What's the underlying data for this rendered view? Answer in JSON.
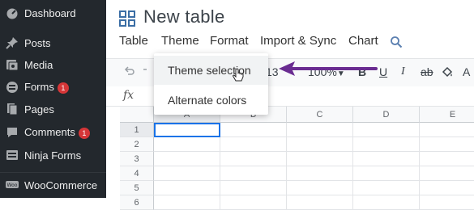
{
  "sidebar": {
    "items": [
      {
        "label": "Dashboard",
        "icon": "dashboard-icon"
      },
      {
        "label": "Posts",
        "icon": "pin-icon"
      },
      {
        "label": "Media",
        "icon": "media-icon"
      },
      {
        "label": "Forms",
        "icon": "forms-icon",
        "badge": "1"
      },
      {
        "label": "Pages",
        "icon": "pages-icon"
      },
      {
        "label": "Comments",
        "icon": "comments-icon",
        "badge": "1"
      },
      {
        "label": "Ninja Forms",
        "icon": "ninja-forms-icon"
      },
      {
        "label": "WooCommerce",
        "icon": "woocommerce-icon"
      }
    ]
  },
  "page": {
    "title": "New table"
  },
  "menu": {
    "items": [
      "Table",
      "Theme",
      "Format",
      "Import & Sync",
      "Chart"
    ],
    "search_icon": "search-icon"
  },
  "toolbar": {
    "font_size": "13",
    "zoom": "100%",
    "bold": "B",
    "underline": "U",
    "italic": "I",
    "strike": "ab",
    "text_color": "A"
  },
  "formula": {
    "label": "fx"
  },
  "grid": {
    "columns": [
      "A",
      "B",
      "C",
      "D",
      "E"
    ],
    "rows": [
      "1",
      "2",
      "3",
      "4",
      "5",
      "6"
    ]
  },
  "dropdown": {
    "items": [
      "Theme selection",
      "Alternate colors"
    ]
  },
  "colors": {
    "sidebar_bg": "#23282d",
    "accent": "#1a73e8",
    "arrow": "#6a2c91",
    "badge": "#d63638"
  }
}
